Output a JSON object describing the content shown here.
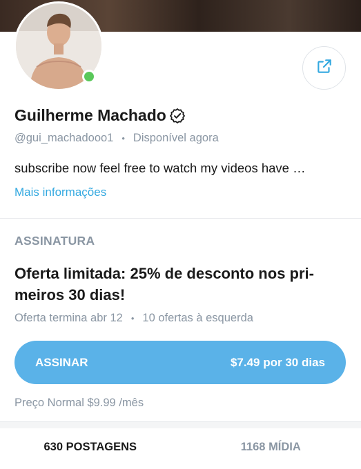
{
  "profile": {
    "name": "Guilherme Machado",
    "handle": "@gui_machadooo1",
    "status": "Disponível agora",
    "bio": "subscribe now feel free to watch my videos have …",
    "more_info": "Mais informações",
    "online": true
  },
  "subscription": {
    "section_label": "ASSINATURA",
    "offer_title": "Oferta limitada: 25% de desconto nos pri-meiros 30 dias!",
    "offer_ends": "Oferta termina abr 12",
    "offers_left": "10 ofertas à esquerda",
    "button_label": "ASSINAR",
    "button_price": "$7.49 por 30 dias",
    "regular_price": "Preço Normal $9.99 /mês"
  },
  "tabs": [
    {
      "label": "630 POSTAGENS",
      "active": true
    },
    {
      "label": "1168 MÍDIA",
      "active": false
    }
  ],
  "colors": {
    "accent": "#5ab2e8",
    "link": "#34a9e0",
    "muted": "#8a96a3",
    "online": "#5ac85a"
  },
  "icons": {
    "share": "share-icon",
    "verified": "verified-badge-icon"
  }
}
